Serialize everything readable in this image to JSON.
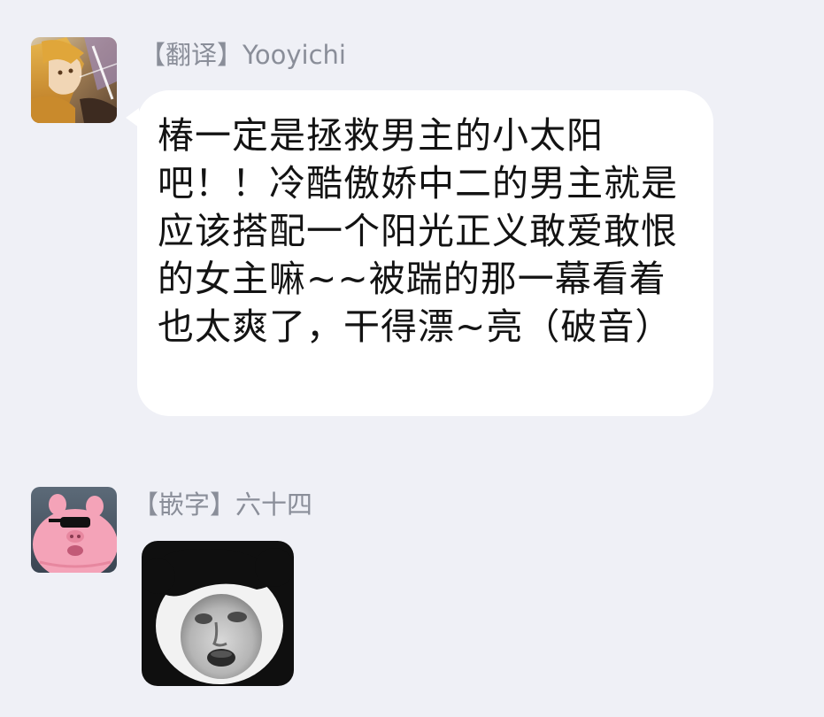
{
  "messages": [
    {
      "sender_tag": "【翻译】",
      "sender_name": "Yooyichi",
      "avatar_icon": "anime-character-avatar",
      "text": "椿一定是拯救男主的小太阳吧！！冷酷傲娇中二的男主就是应该搭配一个阳光正义敢爱敢恨的女主嘛~~被踹的那一幕看着也太爽了，干得漂~亮（破音）"
    },
    {
      "sender_tag": "【嵌字】",
      "sender_name": "六十四",
      "avatar_icon": "pink-pig-sunglasses-avatar",
      "sticker_icon": "panda-meme-face-sticker"
    }
  ],
  "colors": {
    "background": "#eff0f6",
    "bubble": "#ffffff",
    "sender_text": "#8a8e99",
    "message_text": "#131313"
  }
}
